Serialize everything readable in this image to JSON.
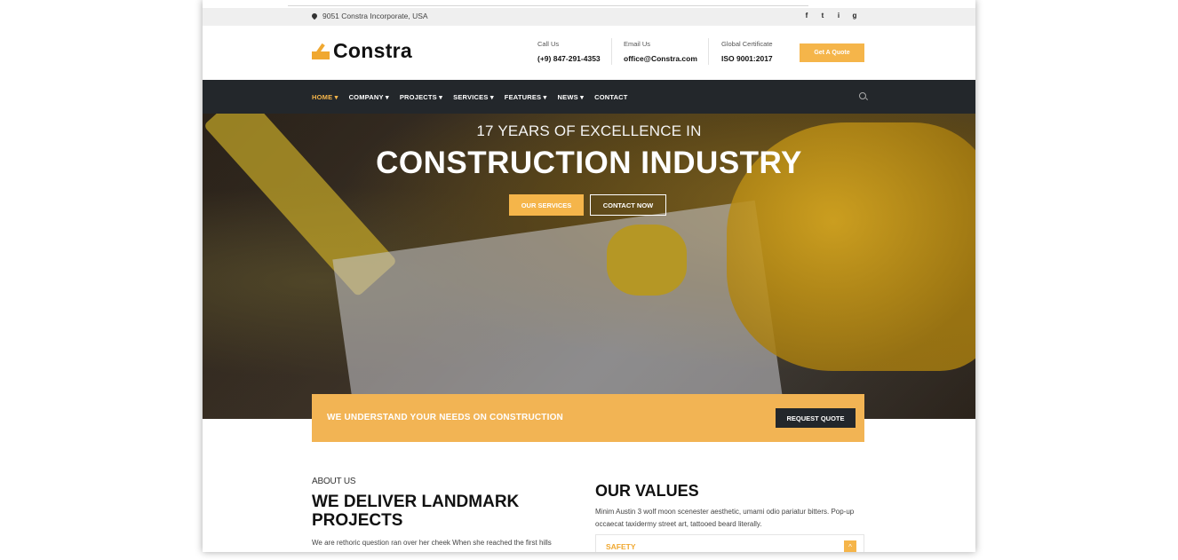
{
  "topbar": {
    "address": "9051 Constra Incorporate, USA",
    "social": [
      "f",
      "t",
      "i",
      "g"
    ]
  },
  "header": {
    "logo": "Constra",
    "call_label": "Call Us",
    "call_value": "(+9) 847-291-4353",
    "email_label": "Email Us",
    "email_value": "office@Constra.com",
    "cert_label": "Global Certificate",
    "cert_value": "ISO 9001:2017",
    "quote_button": "Get A Quote"
  },
  "nav": {
    "items": [
      "HOME",
      "COMPANY",
      "PROJECTS",
      "SERVICES",
      "FEATURES",
      "NEWS",
      "CONTACT"
    ]
  },
  "hero": {
    "subtitle": "17 YEARS OF EXCELLENCE IN",
    "title": "CONSTRUCTION INDUSTRY",
    "button1": "OUR SERVICES",
    "button2": "CONTACT NOW"
  },
  "cta": {
    "text": "WE UNDERSTAND YOUR NEEDS ON CONSTRUCTION",
    "button": "REQUEST QUOTE"
  },
  "about": {
    "eyebrow": "ABOUT US",
    "heading": "WE DELIVER LANDMARK PROJECTS",
    "body": "We are rethoric question ran over her cheek When she reached the first hills"
  },
  "values": {
    "heading": "OUR VALUES",
    "body": "Minim Austin 3 wolf moon scenester aesthetic, umami odio pariatur bitters. Pop-up occaecat taxidermy street art, tattooed beard literally.",
    "accordion_label": "SAFETY",
    "accordion_toggle": "^"
  },
  "colors": {
    "accent": "#f5b54a",
    "dark": "#23272b"
  }
}
